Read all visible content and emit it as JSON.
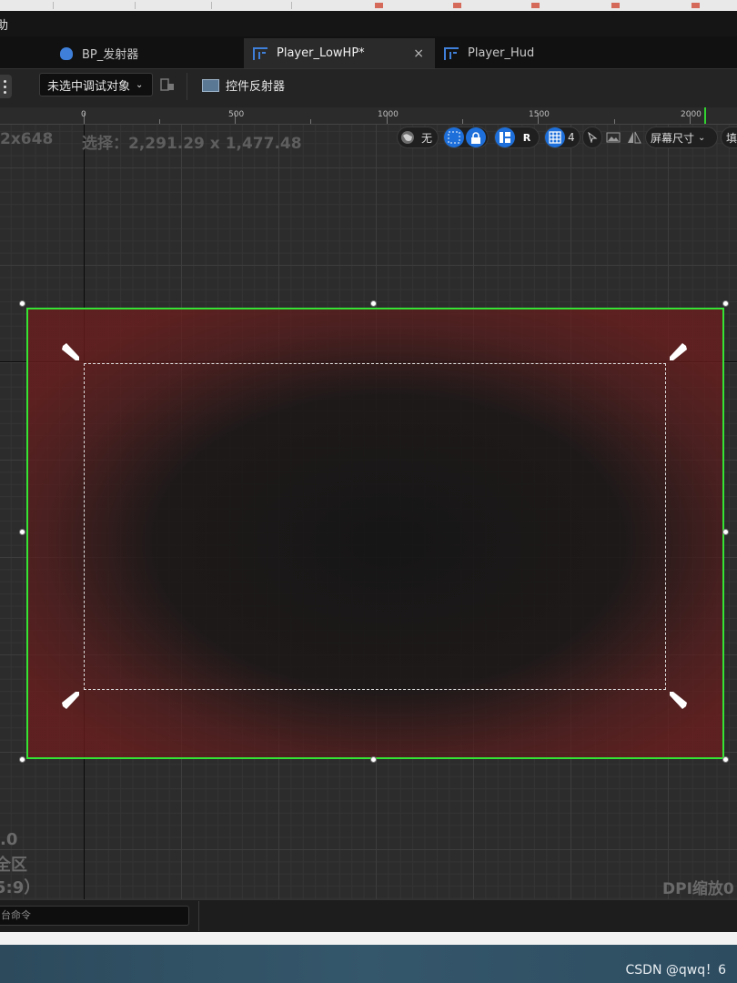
{
  "menu": {
    "item_help": "助"
  },
  "tabs": [
    {
      "label": "BP_发射器",
      "icon": "blueprint-icon"
    },
    {
      "label": "Player_LowHP*",
      "icon": "widget-blueprint-icon",
      "active": true
    },
    {
      "label": "Player_Hud",
      "icon": "widget-blueprint-icon"
    }
  ],
  "tab_close": "×",
  "toolbar": {
    "debug_select": "未选中调试对象",
    "reflector_label": "控件反射器"
  },
  "ruler": {
    "labels": [
      "0",
      "500",
      "1000",
      "1500",
      "2000"
    ]
  },
  "canvas": {
    "resolution_text": "2x648",
    "selection_text": "选择：2,291.29 x 1,477.48",
    "world_label": "无",
    "r_label": "R",
    "grid_count": "4",
    "screen_size_label": "屏幕尺寸",
    "fill_label": "填",
    "corner_info_1": ".0",
    "corner_info_2": "全区",
    "corner_info_3": "5:9）",
    "dpi_text": "DPI缩放0"
  },
  "colors": {
    "selection_border": "#35e335",
    "accent_blue": "#1e6fd9",
    "widget_red": "#6e1c1c"
  },
  "console": {
    "placeholder": "台命令"
  },
  "watermark": "CSDN @qwq！6"
}
